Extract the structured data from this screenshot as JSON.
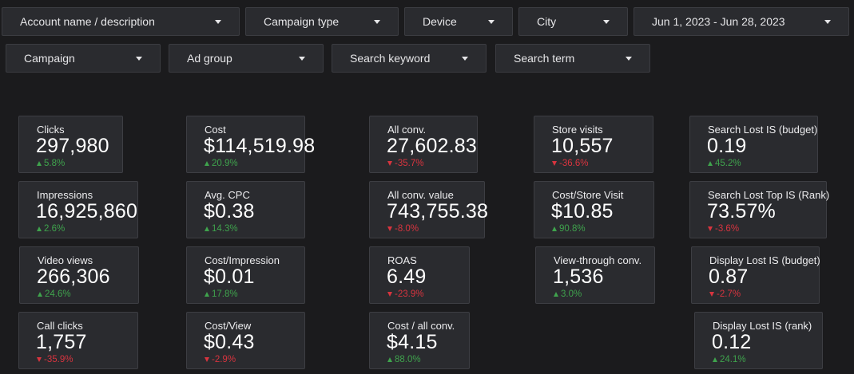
{
  "filters": {
    "account": "Account name / description",
    "campaign_type": "Campaign type",
    "device": "Device",
    "city": "City",
    "date_range": "Jun 1, 2023 - Jun 28, 2023",
    "campaign": "Campaign",
    "ad_group": "Ad group",
    "search_keyword": "Search keyword",
    "search_term": "Search term"
  },
  "metrics": {
    "clicks": {
      "label": "Clicks",
      "value": "297,980",
      "change": "5.8%",
      "direction": "up"
    },
    "impressions": {
      "label": "Impressions",
      "value": "16,925,860",
      "change": "2.6%",
      "direction": "up"
    },
    "video_views": {
      "label": "Video views",
      "value": "266,306",
      "change": "24.6%",
      "direction": "up"
    },
    "call_clicks": {
      "label": "Call clicks",
      "value": "1,757",
      "change": "-35.9%",
      "direction": "down"
    },
    "cost": {
      "label": "Cost",
      "value": "$114,519.98",
      "change": "20.9%",
      "direction": "up"
    },
    "avg_cpc": {
      "label": "Avg. CPC",
      "value": "$0.38",
      "change": "14.3%",
      "direction": "up"
    },
    "cost_impression": {
      "label": "Cost/Impression",
      "value": "$0.01",
      "change": "17.8%",
      "direction": "up"
    },
    "cost_view": {
      "label": "Cost/View",
      "value": "$0.43",
      "change": "-2.9%",
      "direction": "down"
    },
    "all_conv": {
      "label": "All conv.",
      "value": "27,602.83",
      "change": "-35.7%",
      "direction": "down"
    },
    "all_conv_value": {
      "label": "All conv. value",
      "value": "743,755.38",
      "change": "-8.0%",
      "direction": "down"
    },
    "roas": {
      "label": "ROAS",
      "value": "6.49",
      "change": "-23.9%",
      "direction": "down"
    },
    "cost_all_conv": {
      "label": "Cost / all conv.",
      "value": "$4.15",
      "change": "88.0%",
      "direction": "up"
    },
    "store_visits": {
      "label": "Store visits",
      "value": "10,557",
      "change": "-36.6%",
      "direction": "down"
    },
    "cost_store_visit": {
      "label": "Cost/Store Visit",
      "value": "$10.85",
      "change": "90.8%",
      "direction": "up"
    },
    "view_through_conv": {
      "label": "View-through conv.",
      "value": "1,536",
      "change": "3.0%",
      "direction": "up"
    },
    "search_lost_is_budget": {
      "label": "Search Lost IS (budget)",
      "value": "0.19",
      "change": "45.2%",
      "direction": "up"
    },
    "search_lost_top_is_rank": {
      "label": "Search Lost Top IS (Rank)",
      "value": "73.57%",
      "change": "-3.6%",
      "direction": "down"
    },
    "display_lost_is_budget": {
      "label": "Display Lost IS (budget)",
      "value": "0.87",
      "change": "-2.7%",
      "direction": "down"
    },
    "display_lost_is_rank": {
      "label": "Display Lost IS (rank)",
      "value": "0.12",
      "change": "24.1%",
      "direction": "up"
    }
  },
  "colors": {
    "background": "#1b1b1d",
    "card": "#2a2b2f",
    "positive": "#3fa34d",
    "negative": "#d8343f"
  }
}
